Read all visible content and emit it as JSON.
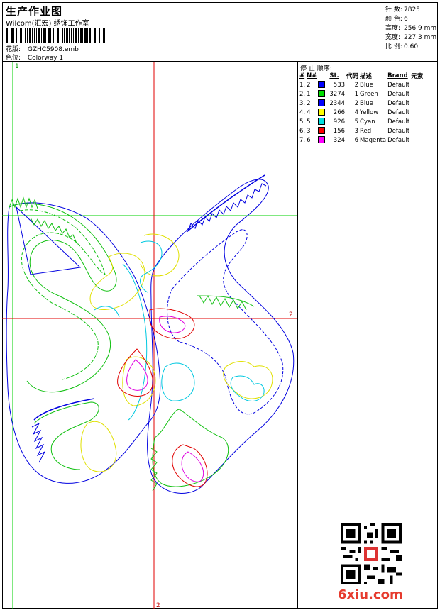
{
  "header": {
    "title": "生产作业图",
    "studio": "Wilcom(汇宏) 绣饰工作室",
    "design_label": "花版:",
    "design_value": "GZHC5908.emb",
    "colorway_label": "色位:",
    "colorway_value": "Colorway 1"
  },
  "stats": {
    "stitches_label": "针 数:",
    "stitches_value": "7825",
    "colors_label": "颜 色:",
    "colors_value": "6",
    "height_label": "高度:",
    "height_value": "256.9 mm",
    "width_label": "宽度:",
    "width_value": "227.3 mm",
    "scale_label": "比 例:",
    "scale_value": "0.60"
  },
  "stop_sequence": {
    "title": "停 止 顺序:",
    "columns": [
      "#",
      "N#",
      "",
      "St.",
      "代码",
      "描述",
      "Brand",
      "元素"
    ],
    "rows": [
      {
        "idx": "1.",
        "n": "2",
        "color": "#0000ff",
        "st": "533",
        "code": "2",
        "desc": "Blue",
        "brand": "Default"
      },
      {
        "idx": "2.",
        "n": "1",
        "color": "#00e000",
        "st": "3274",
        "code": "1",
        "desc": "Green",
        "brand": "Default"
      },
      {
        "idx": "3.",
        "n": "2",
        "color": "#0000ff",
        "st": "2344",
        "code": "2",
        "desc": "Blue",
        "brand": "Default"
      },
      {
        "idx": "4.",
        "n": "4",
        "color": "#ffff00",
        "st": "266",
        "code": "4",
        "desc": "Yellow",
        "brand": "Default"
      },
      {
        "idx": "5.",
        "n": "5",
        "color": "#00e0e0",
        "st": "926",
        "code": "5",
        "desc": "Cyan",
        "brand": "Default"
      },
      {
        "idx": "6.",
        "n": "3",
        "color": "#ff0000",
        "st": "156",
        "code": "3",
        "desc": "Red",
        "brand": "Default"
      },
      {
        "idx": "7.",
        "n": "6",
        "color": "#ff00ff",
        "st": "324",
        "code": "6",
        "desc": "Magenta",
        "brand": "Default"
      }
    ]
  },
  "canvas": {
    "marker_top": "1",
    "marker_right": "2",
    "marker_bottom": "2"
  },
  "watermark": "6xiu.com"
}
